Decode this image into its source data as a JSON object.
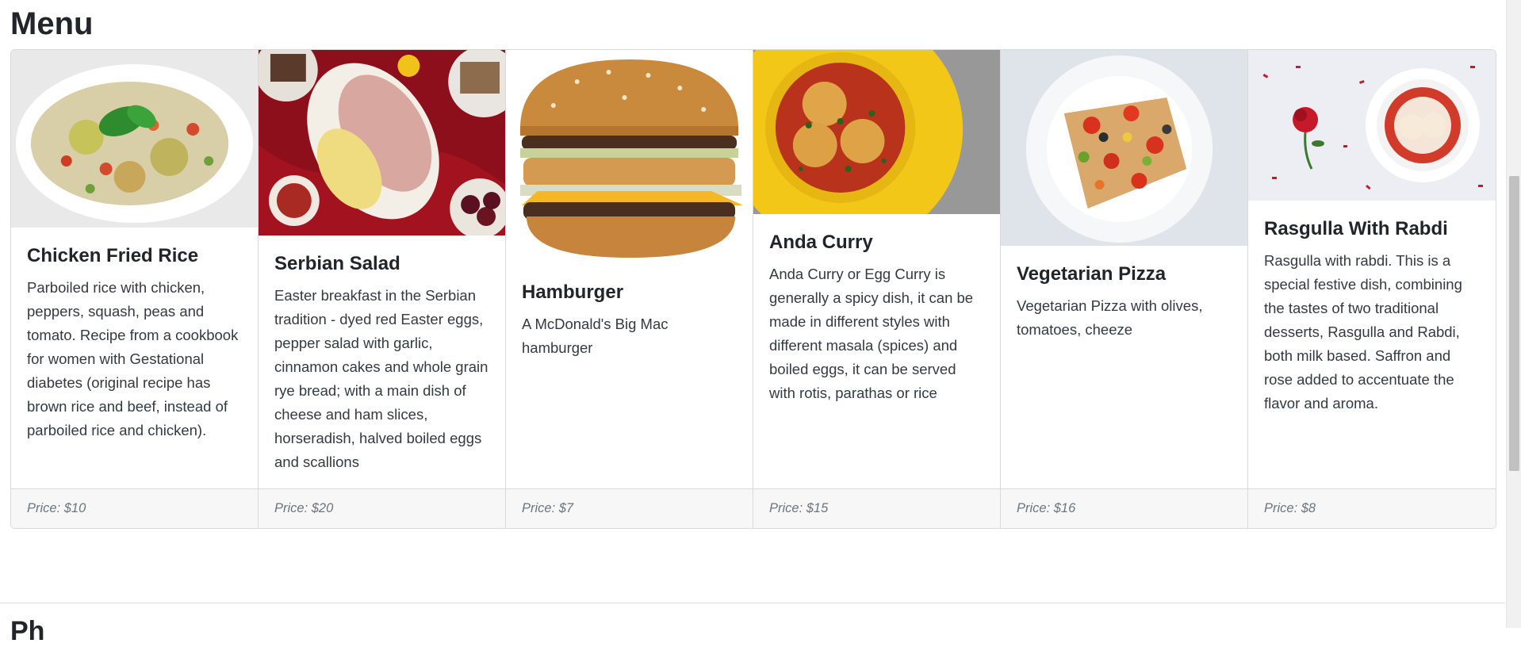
{
  "page": {
    "title": "Menu",
    "next_section_heading": "Ph"
  },
  "menu_items": [
    {
      "name": "Chicken Fried Rice",
      "description": "Parboiled rice with chicken, peppers, squash, peas and tomato. Recipe from a cookbook for women with Gestational diabetes (original recipe has brown rice and beef, instead of parboiled rice and chicken).",
      "price": "Price: $10"
    },
    {
      "name": "Serbian Salad",
      "description": "Easter breakfast in the Serbian tradition - dyed red Easter eggs, pepper salad with garlic, cinnamon cakes and whole grain rye bread; with a main dish of cheese and ham slices, horseradish, halved boiled eggs and scallions",
      "price": "Price: $20"
    },
    {
      "name": "Hamburger",
      "description": "A McDonald's Big Mac hamburger",
      "price": "Price: $7"
    },
    {
      "name": "Anda Curry",
      "description": "Anda Curry or Egg Curry is generally a spicy dish, it can be made in different styles with different masala (spices) and boiled eggs, it can be served with rotis, parathas or rice",
      "price": "Price: $15"
    },
    {
      "name": "Vegetarian Pizza",
      "description": "Vegetarian Pizza with olives, tomatoes, cheeze",
      "price": "Price: $16"
    },
    {
      "name": "Rasgulla With Rabdi",
      "description": "Rasgulla with rabdi. This is a special festive dish, combining the tastes of two traditional desserts, Rasgulla and Rabdi, both milk based. Saffron and rose added to accentuate the flavor and aroma.",
      "price": "Price: $8"
    }
  ]
}
